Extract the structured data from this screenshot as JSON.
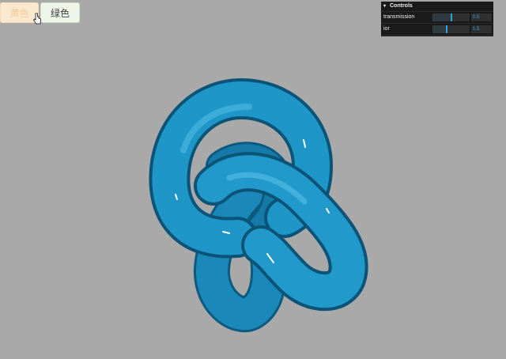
{
  "buttons": {
    "yellow_label": "黄色",
    "green_label": "绿色"
  },
  "controls": {
    "title": "Controls",
    "params": [
      {
        "label": "transmission",
        "value": "0.5",
        "fraction": 0.5
      },
      {
        "label": "ior",
        "value": "1.5",
        "fraction": 0.38
      }
    ]
  },
  "colors": {
    "background": "#a9a9a9",
    "knot": "#1e94c6",
    "accent": "#2fa1d6"
  },
  "icons": [
    "cursor-pointer-icon",
    "chevron-down-icon"
  ]
}
